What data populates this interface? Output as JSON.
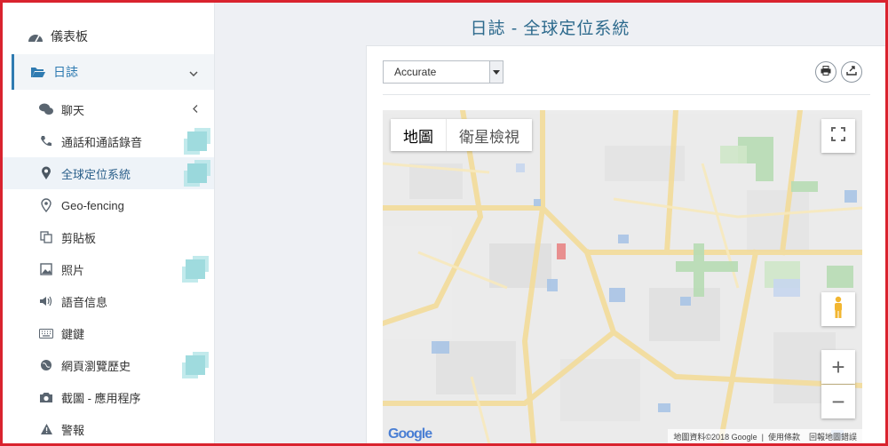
{
  "sidebar": {
    "dashboard": "儀表板",
    "logs": "日誌",
    "items": [
      {
        "label": "聊天",
        "icon": "chat-icon"
      },
      {
        "label": "通話和通話錄音",
        "icon": "phone-icon"
      },
      {
        "label": "全球定位系統",
        "icon": "location-pin-icon"
      },
      {
        "label": "Geo-fencing",
        "icon": "geo-fence-icon"
      },
      {
        "label": "剪貼板",
        "icon": "clipboard-icon"
      },
      {
        "label": "照片",
        "icon": "photo-icon"
      },
      {
        "label": "語音信息",
        "icon": "speaker-icon"
      },
      {
        "label": "鍵鍵",
        "icon": "keyboard-icon"
      },
      {
        "label": "網頁瀏覽歷史",
        "icon": "globe-icon"
      },
      {
        "label": "截圖 - 應用程序",
        "icon": "camera-icon"
      },
      {
        "label": "警報",
        "icon": "warning-icon"
      }
    ]
  },
  "main": {
    "title": "日誌 - 全球定位系統",
    "accuracy": {
      "value": "Accurate"
    }
  },
  "map": {
    "type_map": "地圖",
    "type_satellite": "衛星檢視",
    "attribution_data": "地圖資料©2018 Google",
    "attribution_terms": "使用條款",
    "attribution_report": "回報地圖錯誤",
    "logo": "Google",
    "zoom_in": "+",
    "zoom_out": "−"
  }
}
